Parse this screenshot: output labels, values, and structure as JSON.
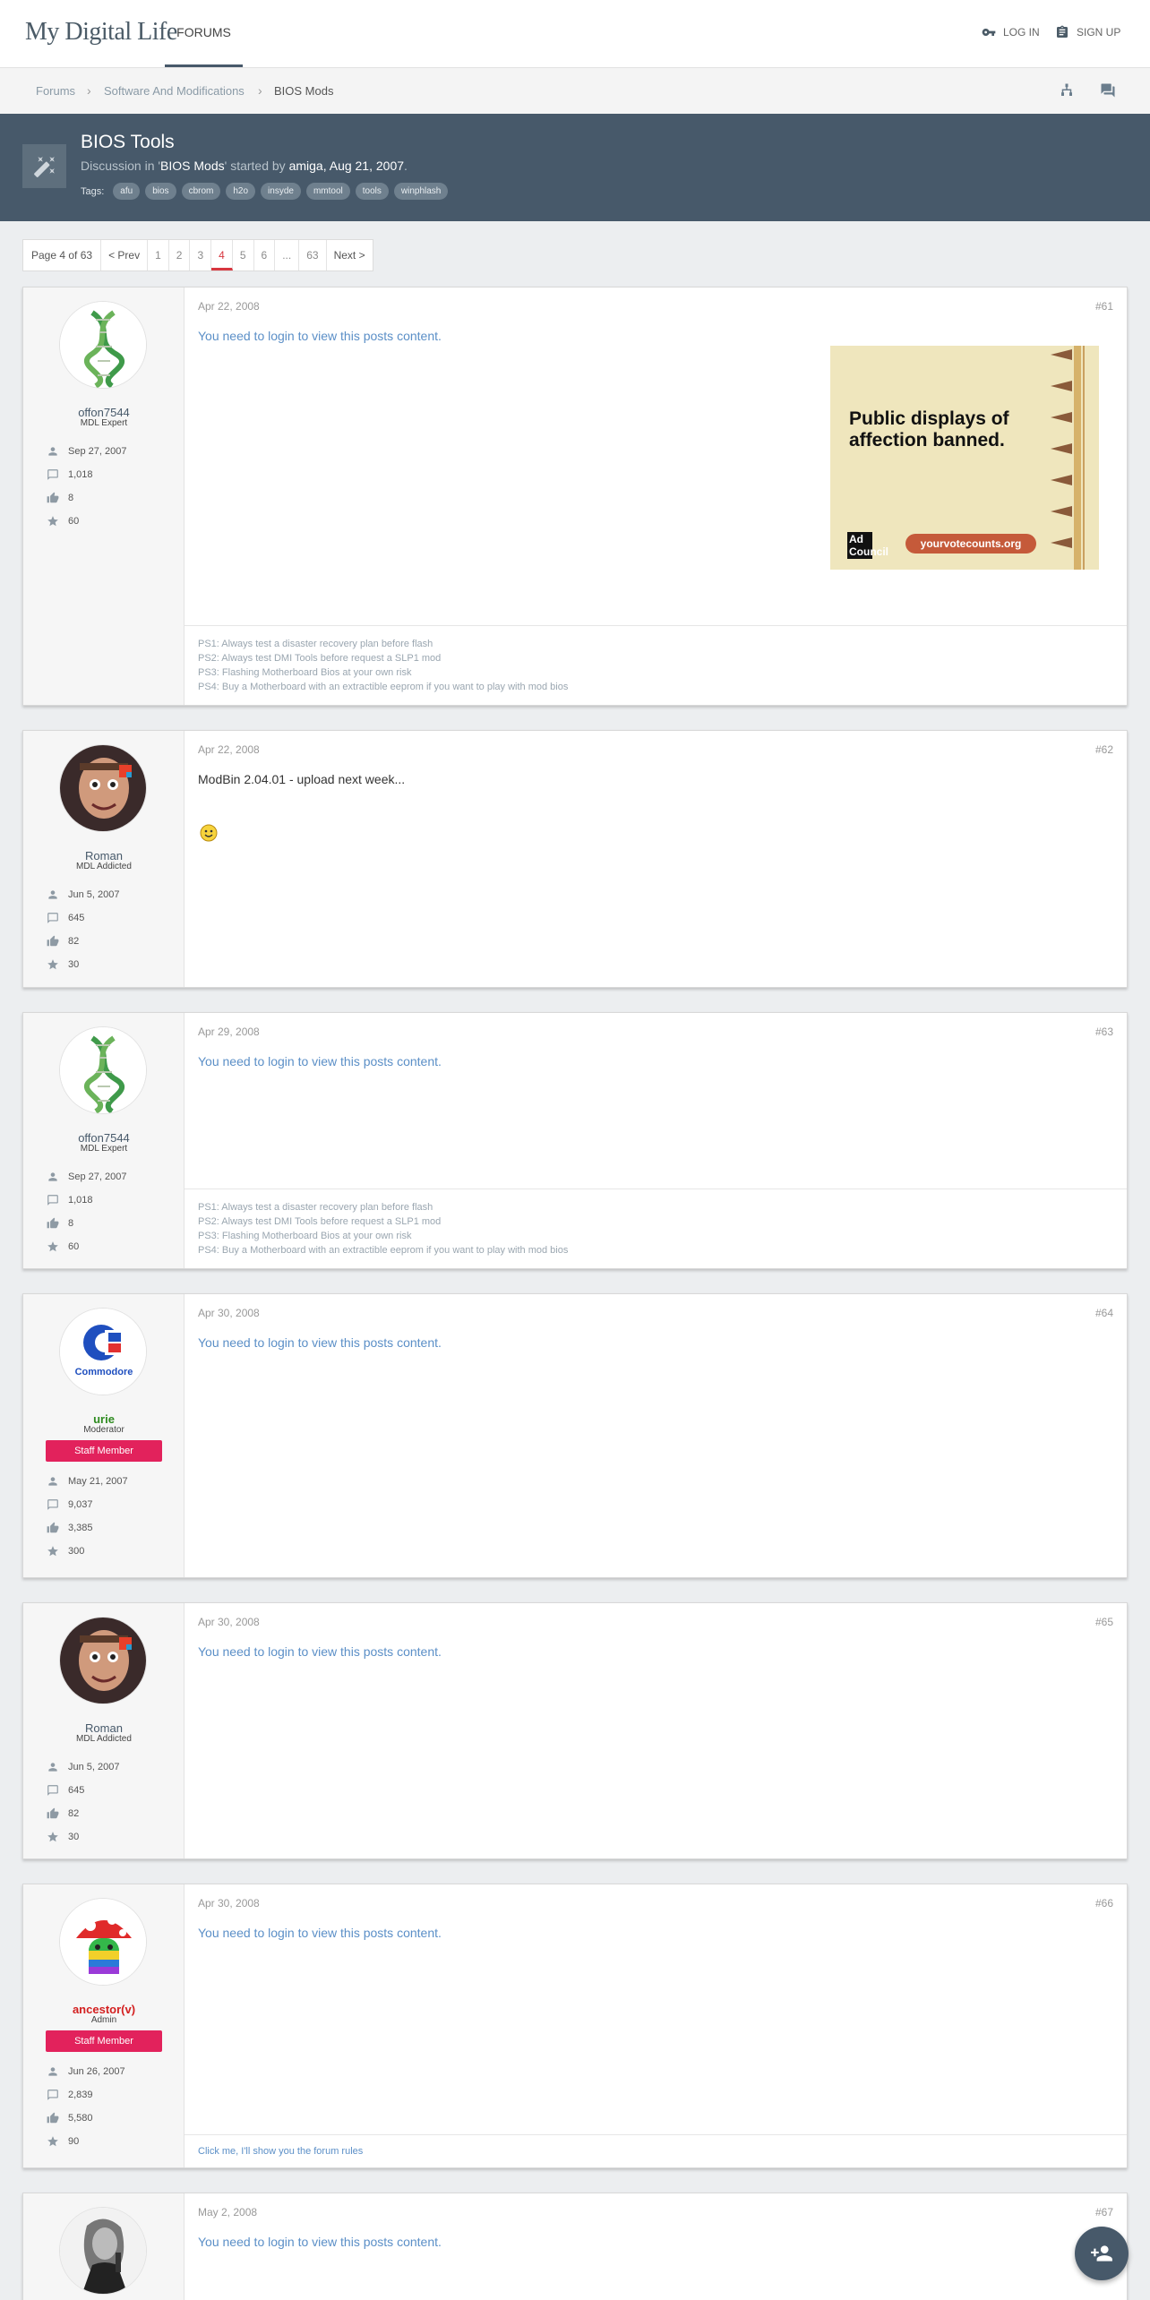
{
  "header": {
    "logo": "My Digital Life",
    "nav_forums": "FORUMS",
    "login": "LOG IN",
    "signup": "SIGN UP"
  },
  "breadcrumb": {
    "items": [
      "Forums",
      "Software And Modifications",
      "BIOS Mods"
    ]
  },
  "thread": {
    "title": "BIOS Tools",
    "meta_prefix": "Discussion in '",
    "forum": "BIOS Mods",
    "meta_mid": "' started by ",
    "author": "amiga",
    "date": ", Aug 21, 2007",
    "meta_end": ".",
    "tags_label": "Tags:",
    "tags": [
      "afu",
      "bios",
      "cbrom",
      "h2o",
      "insyde",
      "mmtool",
      "tools",
      "winphlash"
    ]
  },
  "pagination": {
    "label": "Page 4 of 63",
    "prev": "< Prev",
    "pages": [
      "1",
      "2",
      "3",
      "4",
      "5",
      "6",
      "...",
      "63"
    ],
    "next": "Next >"
  },
  "posts": [
    {
      "date": "Apr 22, 2008",
      "number": "#61",
      "username": "offon7544",
      "user_title": "MDL Expert",
      "joined": "Sep 27, 2007",
      "messages": "1,018",
      "likes": "8",
      "points": "60",
      "body": "You need to login to view this posts content.",
      "signature": [
        "PS1: Always test a disaster recovery plan before flash",
        "PS2: Always test DMI Tools before request a SLP1 mod",
        "PS3: Flashing Motherboard Bios at your own risk",
        "PS4: Buy a Motherboard with an extractible eeprom if you want to play with mod bios"
      ]
    },
    {
      "date": "Apr 22, 2008",
      "number": "#62",
      "username": "Roman",
      "user_title": "MDL Addicted",
      "joined": "Jun 5, 2007",
      "messages": "645",
      "likes": "82",
      "points": "30",
      "body": "ModBin 2.04.01 - upload next week..."
    },
    {
      "date": "Apr 29, 2008",
      "number": "#63",
      "username": "offon7544",
      "user_title": "MDL Expert",
      "joined": "Sep 27, 2007",
      "messages": "1,018",
      "likes": "8",
      "points": "60",
      "body": "You need to login to view this posts content.",
      "signature": [
        "PS1: Always test a disaster recovery plan before flash",
        "PS2: Always test DMI Tools before request a SLP1 mod",
        "PS3: Flashing Motherboard Bios at your own risk",
        "PS4: Buy a Motherboard with an extractible eeprom if you want to play with mod bios"
      ]
    },
    {
      "date": "Apr 30, 2008",
      "number": "#64",
      "username": "urie",
      "user_title": "Moderator",
      "staff": "Staff Member",
      "joined": "May 21, 2007",
      "messages": "9,037",
      "likes": "3,385",
      "points": "300",
      "body": "You need to login to view this posts content."
    },
    {
      "date": "Apr 30, 2008",
      "number": "#65",
      "username": "Roman",
      "user_title": "MDL Addicted",
      "joined": "Jun 5, 2007",
      "messages": "645",
      "likes": "82",
      "points": "30",
      "body": "You need to login to view this posts content."
    },
    {
      "date": "Apr 30, 2008",
      "number": "#66",
      "username": "ancestor(v)",
      "user_title": "Admin",
      "staff": "Staff Member",
      "joined": "Jun 26, 2007",
      "messages": "2,839",
      "likes": "5,580",
      "points": "90",
      "body": "You need to login to view this posts content.",
      "signature_link": "Click me, I'll show you the forum rules"
    },
    {
      "date": "May 2, 2008",
      "number": "#67",
      "body": "You need to login to view this posts content."
    }
  ],
  "ad": {
    "headline": "Public displays of affection banned.",
    "url": "yourvotecounts.org",
    "logo": "Ad Council"
  },
  "colors": {
    "brand": "#47596a",
    "staff_badge": "#e2225c",
    "link": "#5b8fc7",
    "moderator_name": "#2e8b20",
    "admin_name": "#d32020",
    "current_page": "#d7363f"
  },
  "icons": {
    "login": "key-icon",
    "signup": "clipboard-icon",
    "joined": "person-icon",
    "messages": "message-icon",
    "likes": "thumbs-up-icon",
    "points": "star-icon",
    "fab": "add-user-icon"
  }
}
